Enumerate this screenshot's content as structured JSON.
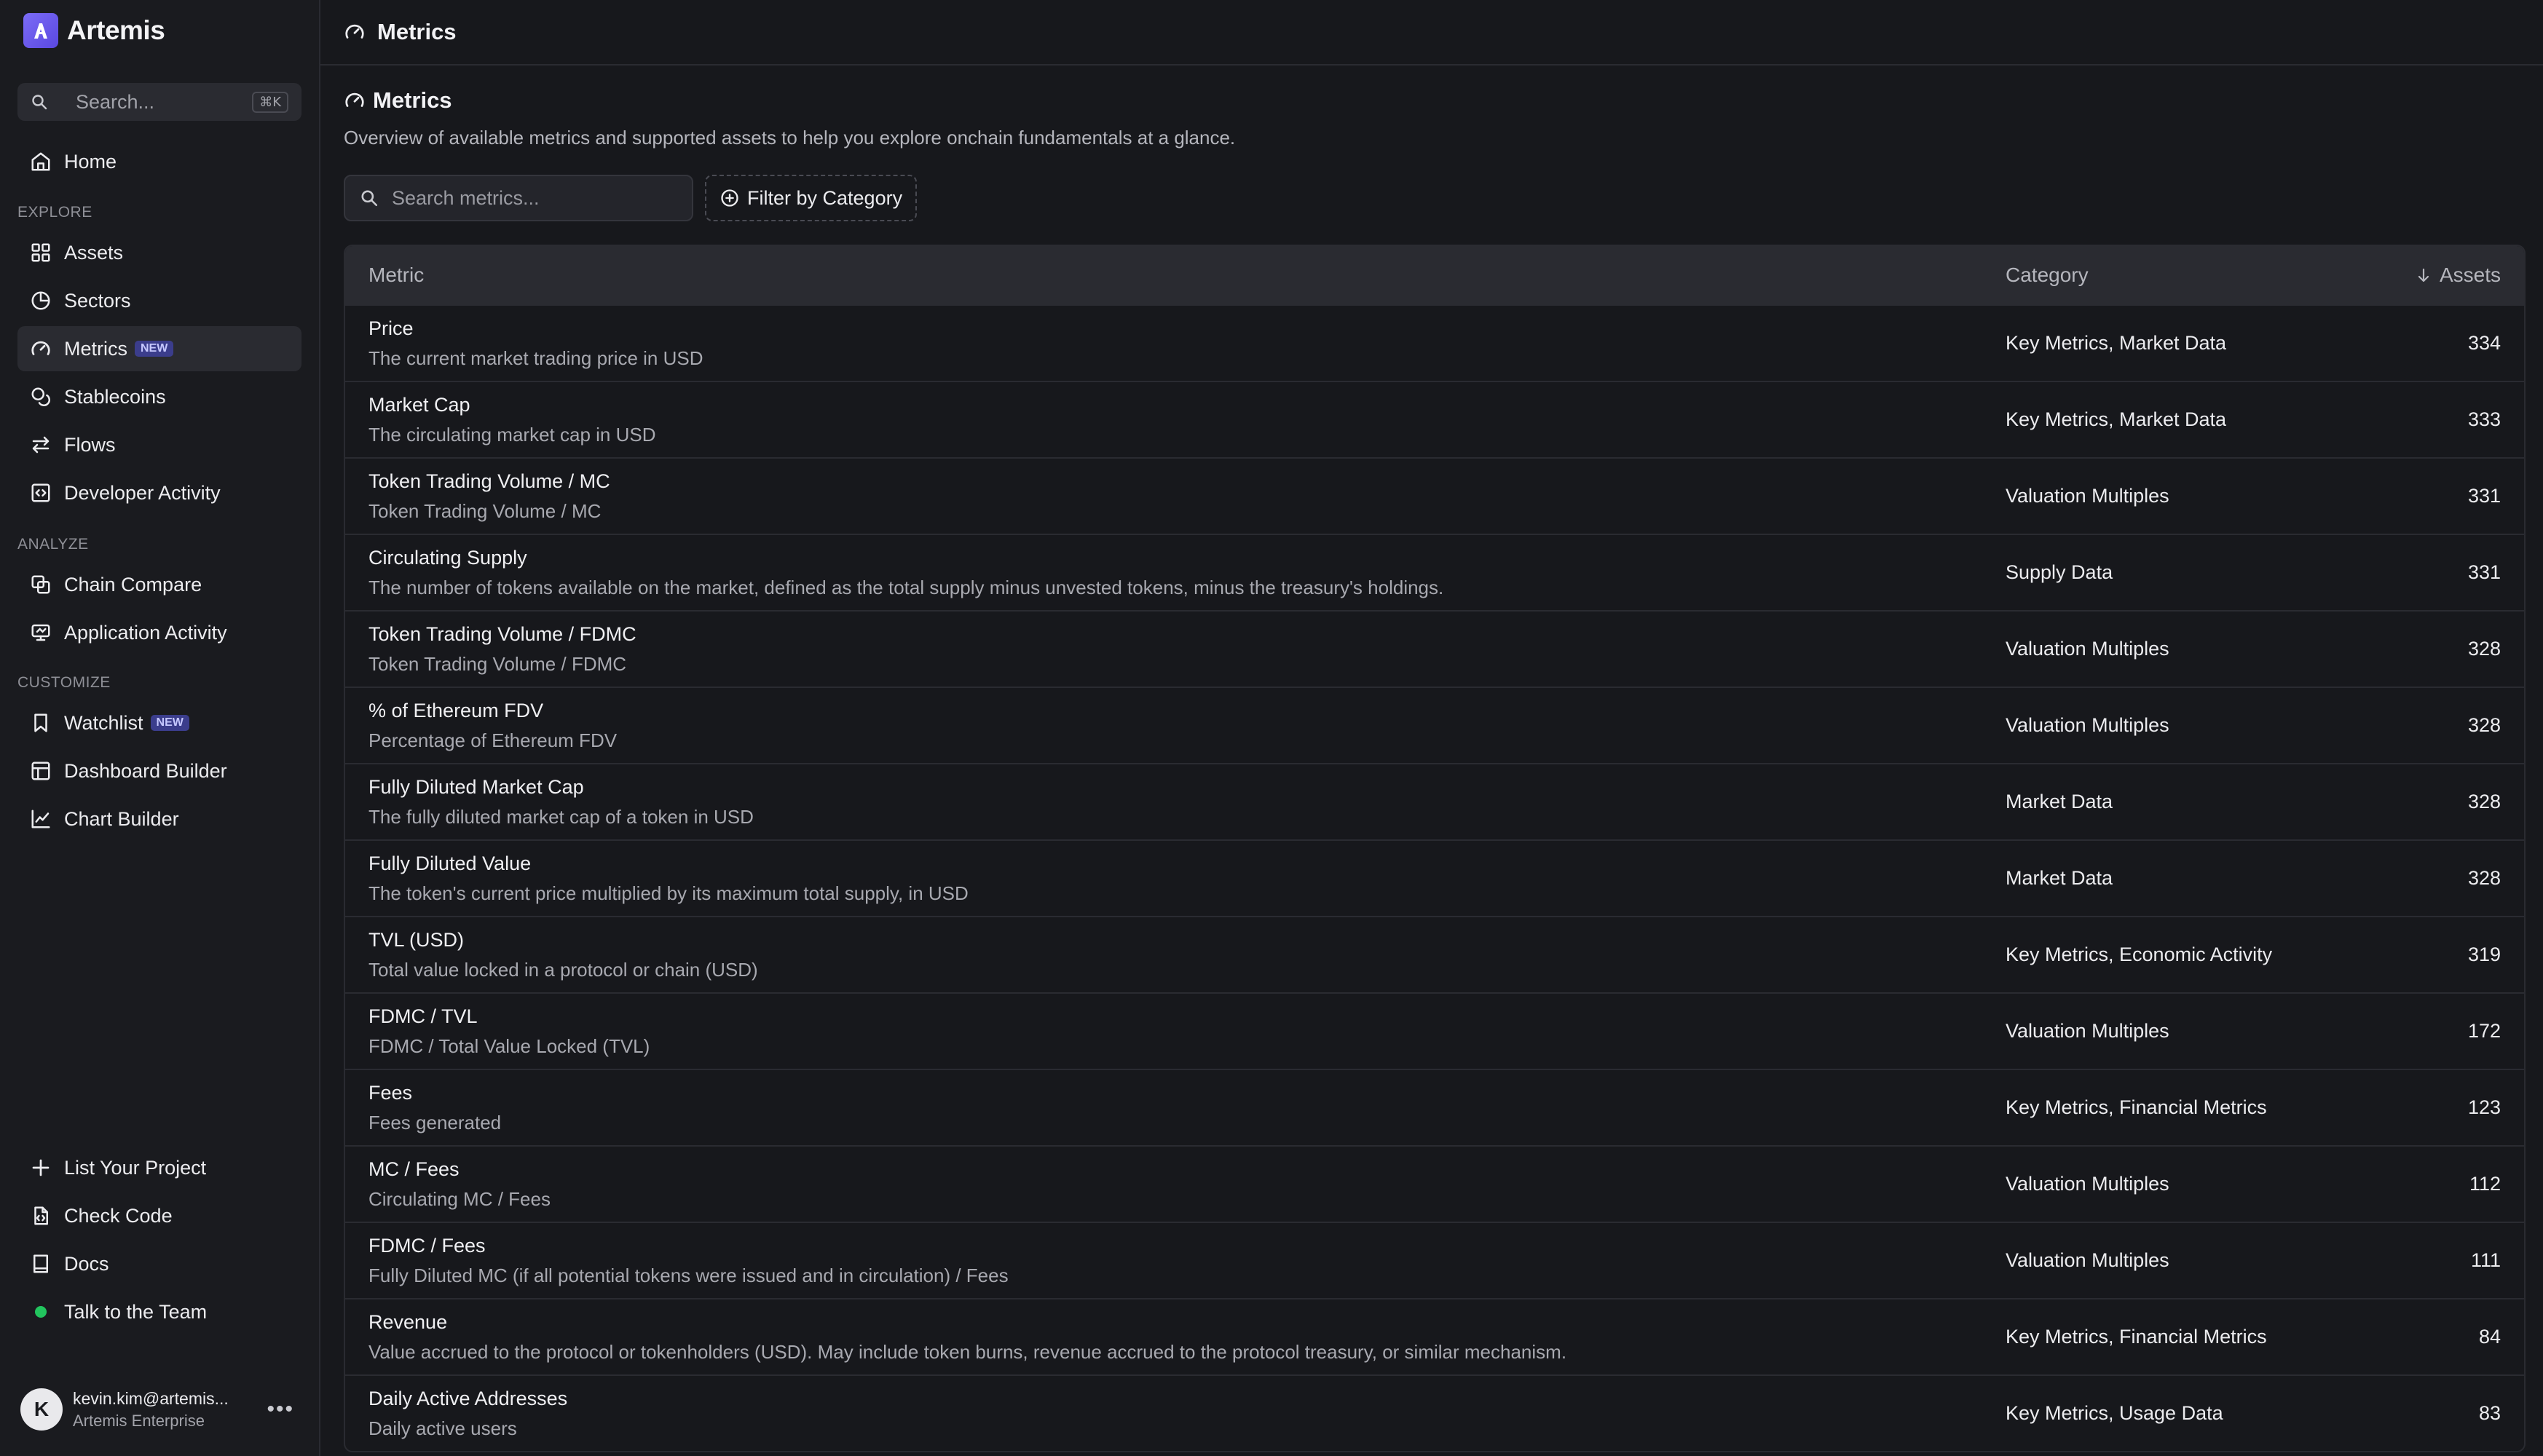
{
  "brand": {
    "name": "Artemis"
  },
  "sidebar": {
    "search_placeholder": "Search...",
    "search_shortcut": "⌘K",
    "home": "Home",
    "explore_label": "EXPLORE",
    "explore": [
      {
        "label": "Assets",
        "icon": "grid-icon"
      },
      {
        "label": "Sectors",
        "icon": "pie-chart-icon"
      },
      {
        "label": "Metrics",
        "icon": "gauge-icon",
        "badge": "NEW"
      },
      {
        "label": "Stablecoins",
        "icon": "coins-icon"
      },
      {
        "label": "Flows",
        "icon": "arrows-exchange-icon"
      },
      {
        "label": "Developer Activity",
        "icon": "code-icon"
      }
    ],
    "analyze_label": "ANALYZE",
    "analyze": [
      {
        "label": "Chain Compare",
        "icon": "compare-icon"
      },
      {
        "label": "Application Activity",
        "icon": "monitor-icon"
      }
    ],
    "customize_label": "CUSTOMIZE",
    "customize": [
      {
        "label": "Watchlist",
        "icon": "bookmark-icon",
        "badge": "NEW"
      },
      {
        "label": "Dashboard Builder",
        "icon": "layout-icon"
      },
      {
        "label": "Chart Builder",
        "icon": "line-chart-icon"
      }
    ],
    "bottom": [
      {
        "label": "List Your Project",
        "icon": "plus-icon"
      },
      {
        "label": "Check Code",
        "icon": "file-code-icon"
      },
      {
        "label": "Docs",
        "icon": "book-icon"
      },
      {
        "label": "Talk to the Team",
        "icon": "status-dot"
      }
    ],
    "user": {
      "initial": "K",
      "email": "kevin.kim@artemis...",
      "plan": "Artemis Enterprise"
    }
  },
  "topbar": {
    "title": "Metrics"
  },
  "page": {
    "title": "Metrics",
    "subtitle": "Overview of available metrics and supported assets to help you explore onchain fundamentals at a glance.",
    "search_placeholder": "Search metrics...",
    "filter_label": "Filter by Category"
  },
  "table": {
    "headers": {
      "metric": "Metric",
      "category": "Category",
      "assets": "Assets"
    },
    "rows": [
      {
        "name": "Price",
        "desc": "The current market trading price in USD",
        "category": "Key Metrics, Market Data",
        "assets": "334"
      },
      {
        "name": "Market Cap",
        "desc": "The circulating market cap in USD",
        "category": "Key Metrics, Market Data",
        "assets": "333"
      },
      {
        "name": "Token Trading Volume / MC",
        "desc": "Token Trading Volume / MC",
        "category": "Valuation Multiples",
        "assets": "331"
      },
      {
        "name": "Circulating Supply",
        "desc": "The number of tokens available on the market, defined as the total supply minus unvested tokens, minus the treasury's holdings.",
        "category": "Supply Data",
        "assets": "331"
      },
      {
        "name": "Token Trading Volume / FDMC",
        "desc": "Token Trading Volume / FDMC",
        "category": "Valuation Multiples",
        "assets": "328"
      },
      {
        "name": "% of Ethereum FDV",
        "desc": "Percentage of Ethereum FDV",
        "category": "Valuation Multiples",
        "assets": "328"
      },
      {
        "name": "Fully Diluted Market Cap",
        "desc": "The fully diluted market cap of a token in USD",
        "category": "Market Data",
        "assets": "328"
      },
      {
        "name": "Fully Diluted Value",
        "desc": "The token's current price multiplied by its maximum total supply, in USD",
        "category": "Market Data",
        "assets": "328"
      },
      {
        "name": "TVL (USD)",
        "desc": "Total value locked in a protocol or chain (USD)",
        "category": "Key Metrics, Economic Activity",
        "assets": "319"
      },
      {
        "name": "FDMC / TVL",
        "desc": "FDMC / Total Value Locked (TVL)",
        "category": "Valuation Multiples",
        "assets": "172"
      },
      {
        "name": "Fees",
        "desc": "Fees generated",
        "category": "Key Metrics, Financial Metrics",
        "assets": "123"
      },
      {
        "name": "MC / Fees",
        "desc": "Circulating MC / Fees",
        "category": "Valuation Multiples",
        "assets": "112"
      },
      {
        "name": "FDMC / Fees",
        "desc": "Fully Diluted MC (if all potential tokens were issued and in circulation) / Fees",
        "category": "Valuation Multiples",
        "assets": "111"
      },
      {
        "name": "Revenue",
        "desc": "Value accrued to the protocol or tokenholders (USD). May include token burns, revenue accrued to the protocol treasury, or similar mechanism.",
        "category": "Key Metrics, Financial Metrics",
        "assets": "84"
      },
      {
        "name": "Daily Active Addresses",
        "desc": "Daily active users",
        "category": "Key Metrics, Usage Data",
        "assets": "83"
      }
    ]
  }
}
